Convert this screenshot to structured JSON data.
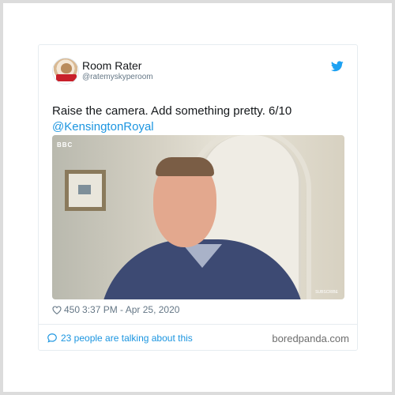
{
  "tweet": {
    "author_name": "Room Rater",
    "author_handle": "@ratemyskyperoom",
    "text": "Raise the camera. Add something pretty. 6/10",
    "mention": "@KensingtonRoyal",
    "likes": "450",
    "timestamp": "3:37 PM - Apr 25, 2020",
    "talking": "23 people are talking about this"
  },
  "media": {
    "broadcaster": "BBC",
    "overlay": "SUBSCRIBE"
  },
  "watermark": "boredpanda.com",
  "colors": {
    "link": "#1b95e0",
    "meta": "#657786",
    "border": "#e6ecf0"
  },
  "icons": [
    "twitter-bird-icon",
    "heart-icon",
    "comment-bubble-icon"
  ]
}
